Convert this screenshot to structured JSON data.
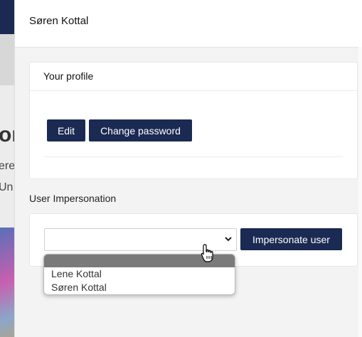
{
  "background": {
    "heading_fragment": "or",
    "text_line_1": "ere",
    "text_line_2": "Un"
  },
  "panel": {
    "title": "Søren Kottal"
  },
  "profile": {
    "title": "Your profile",
    "edit_label": "Edit",
    "change_password_label": "Change password"
  },
  "impersonation": {
    "section_label": "User Impersonation",
    "select_value": "",
    "button_label": "Impersonate user",
    "options": [
      "Lene Kottal",
      "Søren Kottal"
    ]
  },
  "colors": {
    "primary": "#1b2a52",
    "highlight": "#7a7a7a"
  }
}
